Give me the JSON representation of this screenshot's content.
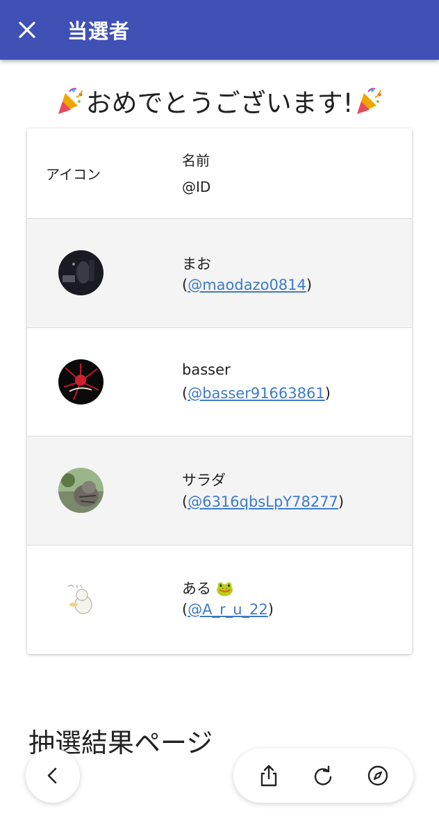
{
  "app_bar": {
    "title": "当選者",
    "accent_color": "#3f51b5",
    "close_icon": "close-icon"
  },
  "congrats": {
    "text": "おめでとうございます!",
    "icon": "party-popper-icon"
  },
  "table": {
    "headers": {
      "icon": "アイコン",
      "name": "名前",
      "id": "@ID"
    },
    "winners": [
      {
        "name": "まお",
        "handle": "@maodazo0814",
        "avatar": "dark-photo-avatar"
      },
      {
        "name": "basser",
        "handle": "@basser91663861",
        "avatar": "red-logo-avatar"
      },
      {
        "name": "サラダ",
        "handle": "@6316qbsLpY78277",
        "avatar": "cat-photo-avatar"
      },
      {
        "name": "ある 🐸",
        "handle": "@A_r_u_22",
        "avatar": "sketch-avatar"
      }
    ],
    "paren_open": "(",
    "paren_close": ")",
    "link_color": "#3d7ac8"
  },
  "results_title": "抽選結果ページ",
  "browser_nav": {
    "back_icon": "chevron-left-icon",
    "share_icon": "share-icon",
    "reload_icon": "reload-icon",
    "compass_icon": "compass-icon"
  }
}
